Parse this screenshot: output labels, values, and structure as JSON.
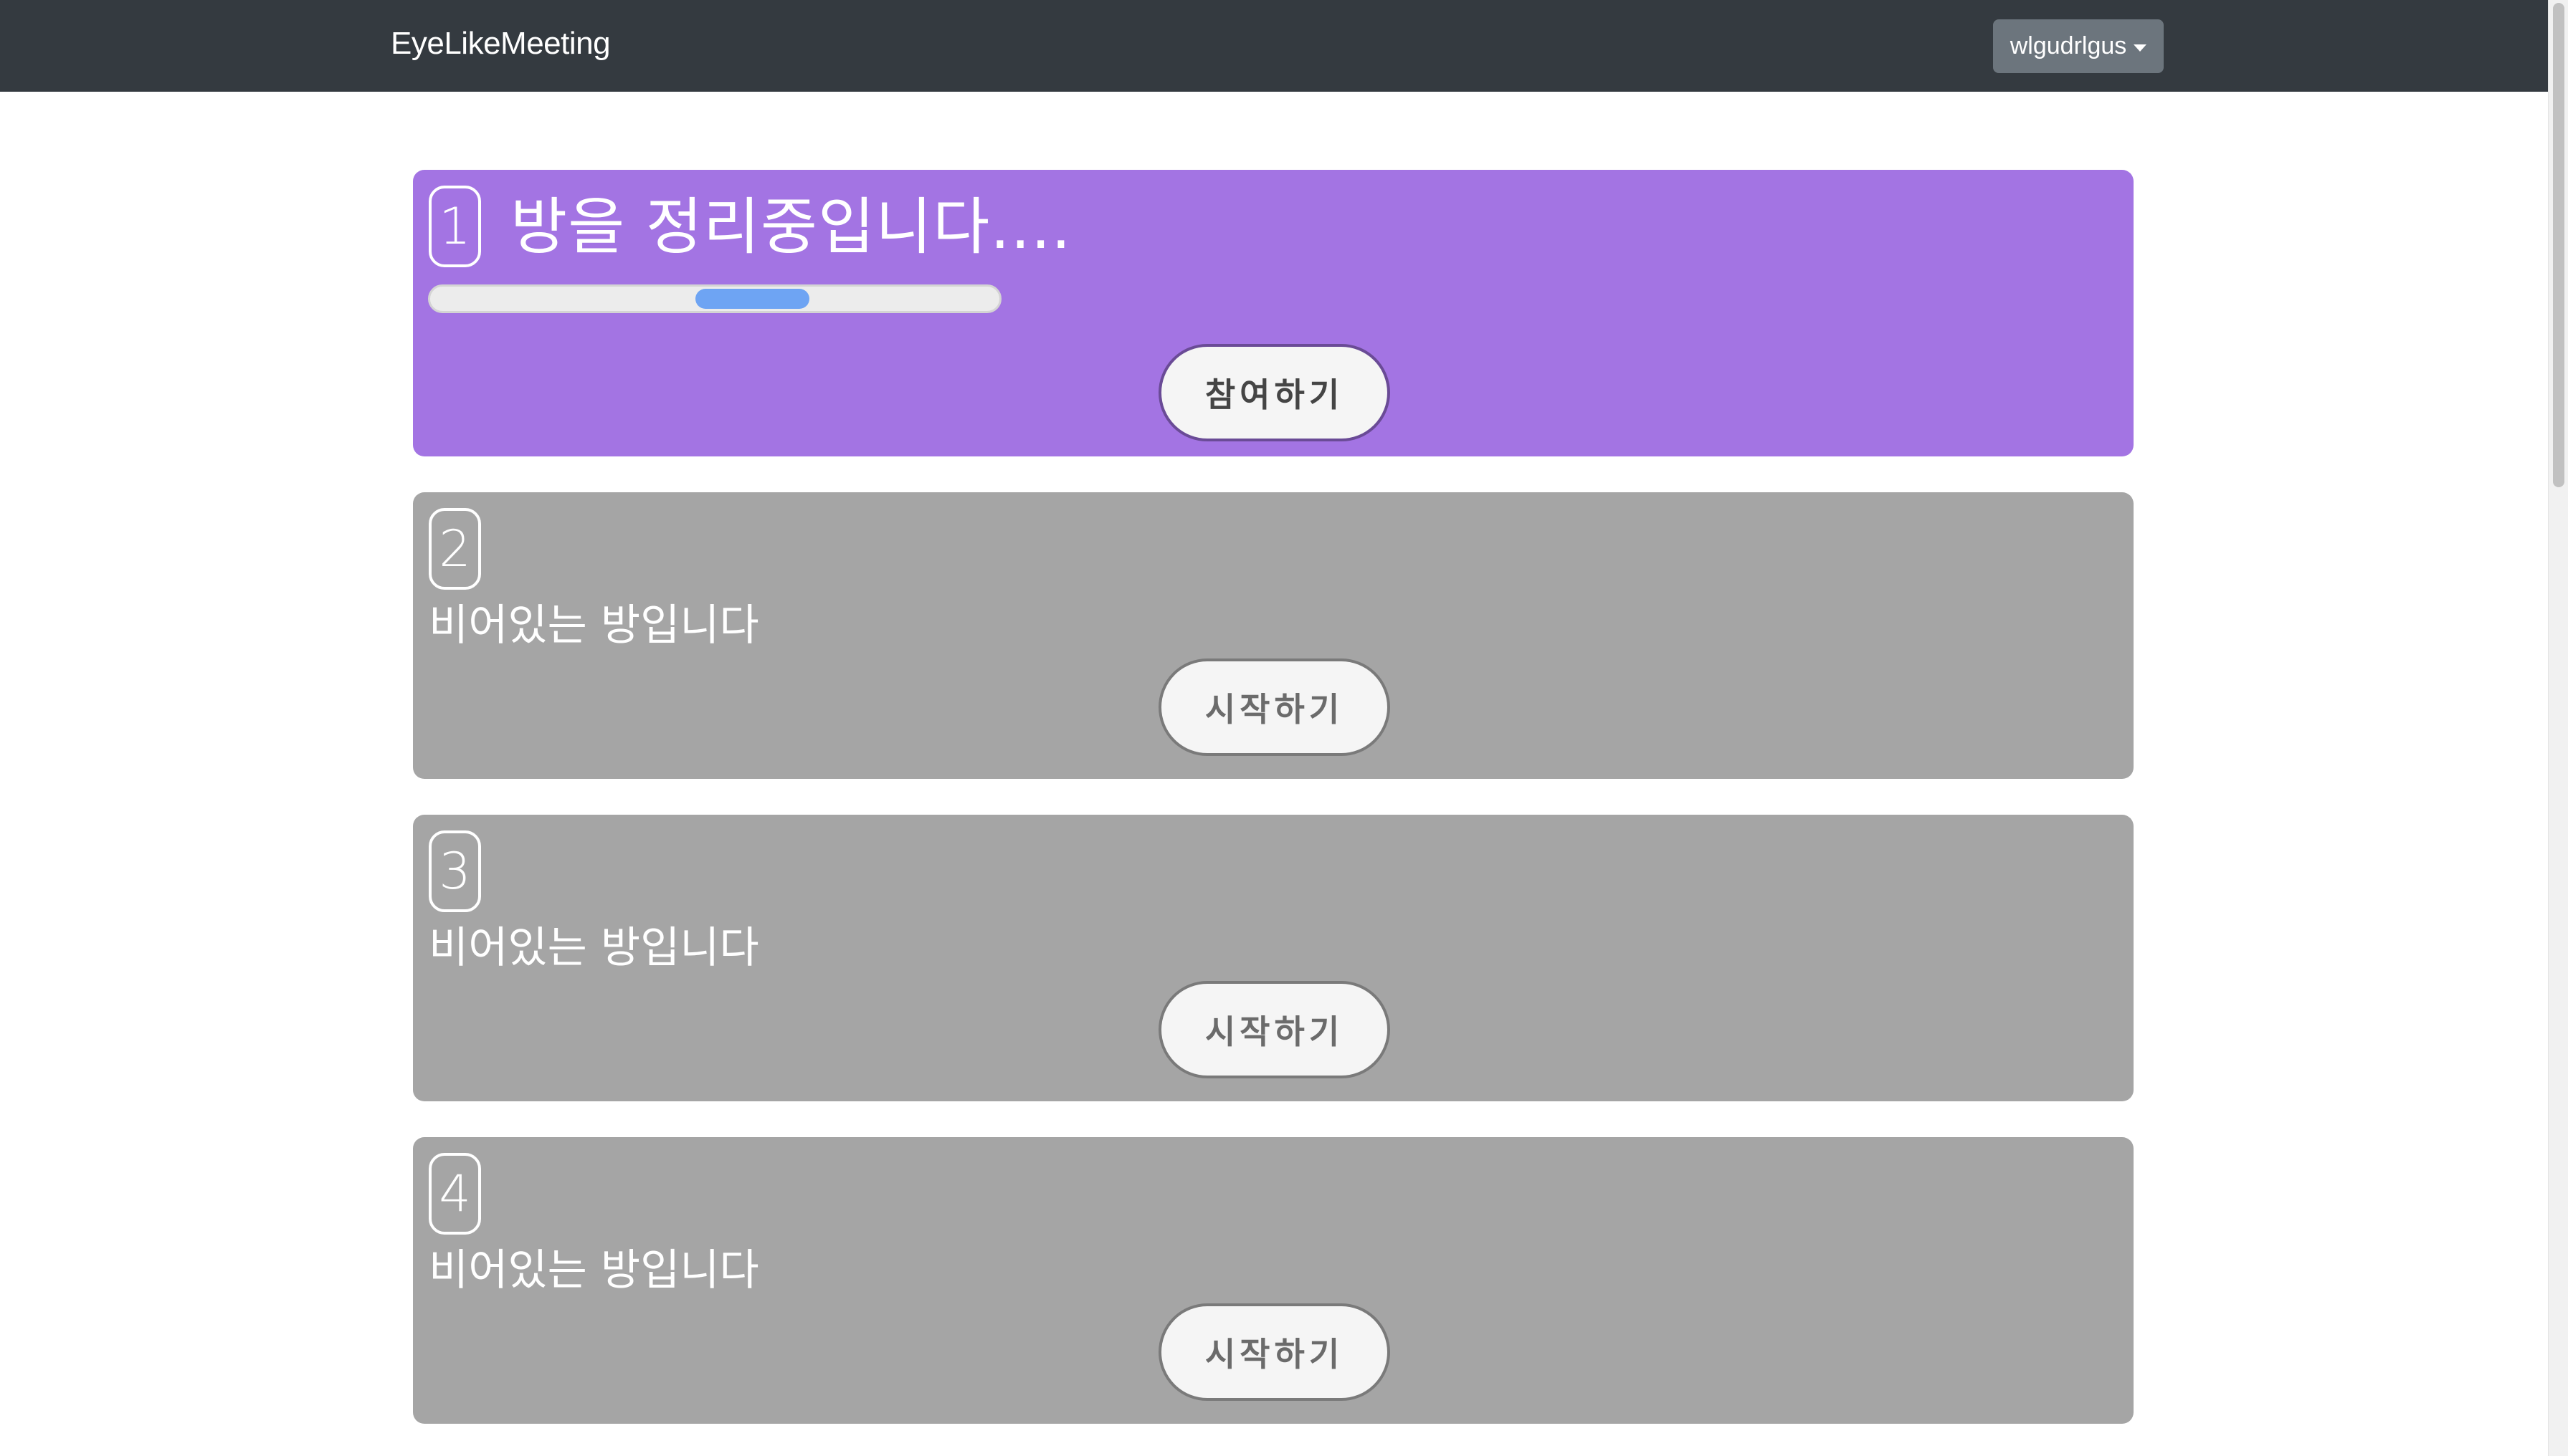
{
  "navbar": {
    "brand": "EyeLikeMeeting",
    "user": "wlgudrlgus"
  },
  "rooms": [
    {
      "number": "1",
      "title": "방을 정리중입니다....",
      "progress": 0.2,
      "button": "참여하기",
      "state": "active"
    },
    {
      "number": "2",
      "status": "비어있는 방입니다",
      "button": "시작하기",
      "state": "empty"
    },
    {
      "number": "3",
      "status": "비어있는 방입니다",
      "button": "시작하기",
      "state": "empty"
    },
    {
      "number": "4",
      "status": "비어있는 방입니다",
      "button": "시작하기",
      "state": "empty"
    }
  ],
  "colors": {
    "navbar": "#343a40",
    "active_room": "#a374e3",
    "empty_room": "#a5a5a5",
    "progress": "#6ea4f3"
  }
}
